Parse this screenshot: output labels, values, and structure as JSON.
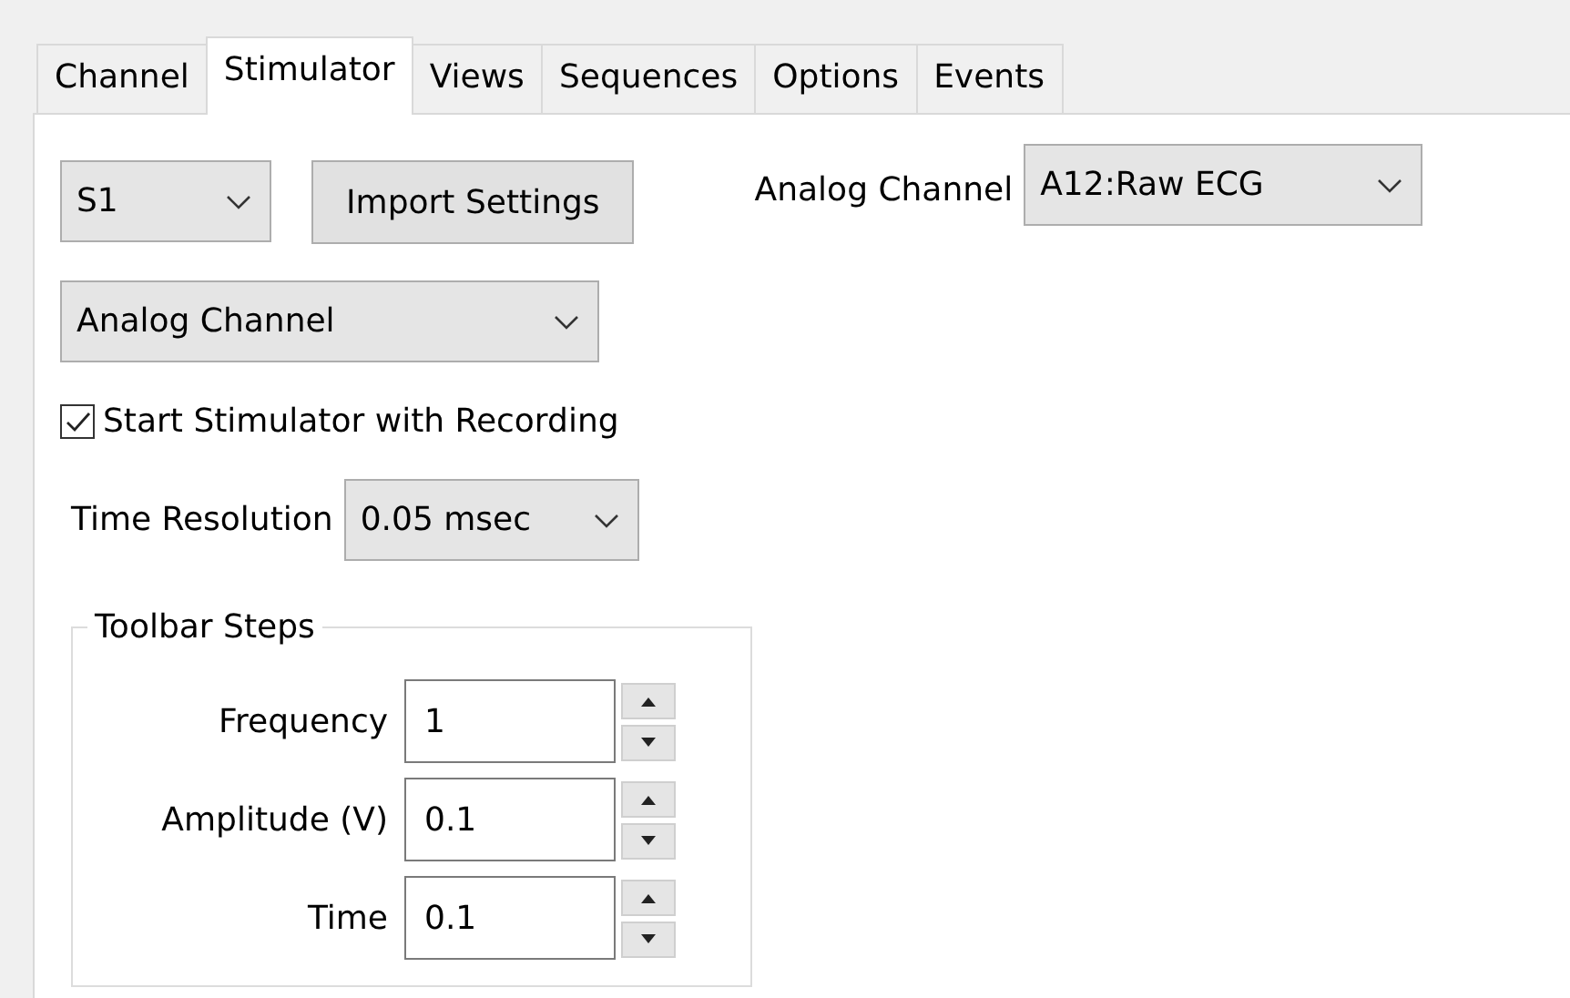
{
  "tabs": [
    {
      "label": "Channel",
      "selected": false
    },
    {
      "label": "Stimulator",
      "selected": true
    },
    {
      "label": "Views",
      "selected": false
    },
    {
      "label": "Sequences",
      "selected": false
    },
    {
      "label": "Options",
      "selected": false
    },
    {
      "label": "Events",
      "selected": false
    }
  ],
  "stimulator": {
    "selector": {
      "value": "S1"
    },
    "import_button": "Import Settings",
    "analog_channel": {
      "label": "Analog Channel",
      "value": "A12:Raw ECG"
    },
    "source": {
      "value": "Analog Channel"
    },
    "start_with_recording": {
      "label": "Start Stimulator with Recording",
      "checked": true
    },
    "time_resolution": {
      "label": "Time Resolution",
      "value": "0.05 msec"
    },
    "toolbar_steps": {
      "title": "Toolbar Steps",
      "fields": [
        {
          "label": "Frequency",
          "value": "1"
        },
        {
          "label": "Amplitude (V)",
          "value": "0.1"
        },
        {
          "label": "Time",
          "value": "0.1"
        }
      ]
    }
  }
}
